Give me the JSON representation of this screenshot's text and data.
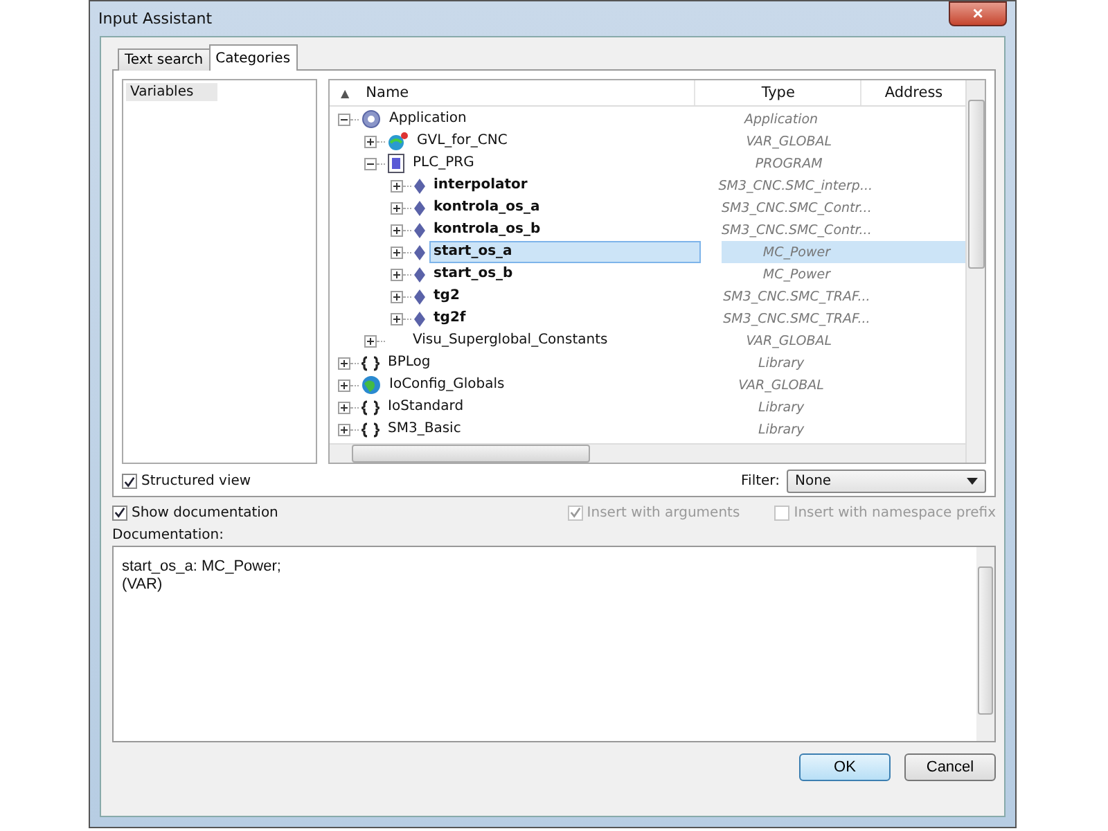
{
  "window": {
    "title": "Input Assistant",
    "close": "×"
  },
  "tabs": [
    {
      "label": "Text search",
      "selected": false
    },
    {
      "label": "Categories",
      "selected": true
    }
  ],
  "categories": [
    {
      "label": "Variables",
      "selected": true
    }
  ],
  "table": {
    "sort_arrow": "▲",
    "columns": [
      "Name",
      "Type",
      "Address"
    ],
    "rows": [
      {
        "name": "Application",
        "type": "Application",
        "kind": "gear",
        "expanded": true,
        "selected": false,
        "children": [
          {
            "name": "GVL_for_CNC",
            "type": "VAR_GLOBAL",
            "kind": "globe-doc",
            "expanded": false,
            "selected": false
          },
          {
            "name": "PLC_PRG",
            "type": "PROGRAM",
            "kind": "program",
            "expanded": true,
            "selected": false,
            "children": [
              {
                "name": "interpolator",
                "type": "SM3_CNC.SMC_interp...",
                "kind": "variable",
                "expanded": false,
                "selected": false
              },
              {
                "name": "kontrola_os_a",
                "type": "SM3_CNC.SMC_Contr...",
                "kind": "variable",
                "expanded": false,
                "selected": false
              },
              {
                "name": "kontrola_os_b",
                "type": "SM3_CNC.SMC_Contr...",
                "kind": "variable",
                "expanded": false,
                "selected": false
              },
              {
                "name": "start_os_a",
                "type": "MC_Power",
                "kind": "variable",
                "expanded": false,
                "selected": true
              },
              {
                "name": "start_os_b",
                "type": "MC_Power",
                "kind": "variable",
                "expanded": false,
                "selected": false
              },
              {
                "name": "tg2",
                "type": "SM3_CNC.SMC_TRAF...",
                "kind": "variable",
                "expanded": false,
                "selected": false
              },
              {
                "name": "tg2f",
                "type": "SM3_CNC.SMC_TRAF...",
                "kind": "variable",
                "expanded": false,
                "selected": false
              }
            ]
          },
          {
            "name": "Visu_Superglobal_Constants",
            "type": "VAR_GLOBAL",
            "kind": "none",
            "expanded": false,
            "selected": false
          }
        ]
      },
      {
        "name": "BPLog",
        "type": "Library",
        "kind": "braces",
        "expanded": false,
        "selected": false
      },
      {
        "name": "IoConfig_Globals",
        "type": "VAR_GLOBAL",
        "kind": "globe",
        "expanded": false,
        "selected": false
      },
      {
        "name": "IoStandard",
        "type": "Library",
        "kind": "braces",
        "expanded": false,
        "selected": false
      },
      {
        "name": "SM3_Basic",
        "type": "Library",
        "kind": "braces",
        "expanded": false,
        "selected": false
      }
    ]
  },
  "structured_view": {
    "label": "Structured view",
    "checked": true
  },
  "filter": {
    "label": "Filter:",
    "value": "None"
  },
  "options": [
    {
      "label": "Show documentation",
      "checked": true,
      "disabled": false
    },
    {
      "label": "Insert with arguments",
      "checked": true,
      "disabled": true
    },
    {
      "label": "Insert with namespace prefix",
      "checked": false,
      "disabled": true
    }
  ],
  "documentation": {
    "label": "Documentation:",
    "lines": [
      "start_os_a: MC_Power;",
      "(VAR)"
    ]
  },
  "buttons": [
    {
      "label": "OK",
      "kind": "default"
    },
    {
      "label": "Cancel",
      "kind": "normal"
    }
  ]
}
